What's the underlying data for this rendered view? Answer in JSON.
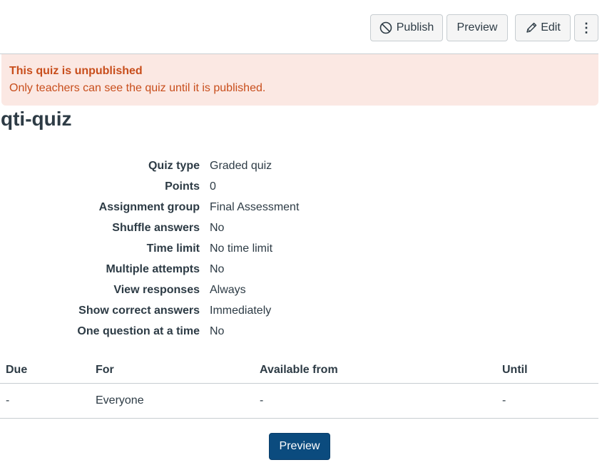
{
  "toolbar": {
    "publish_label": "Publish",
    "preview_label": "Preview",
    "edit_label": "Edit",
    "more_glyph": "⋮"
  },
  "alert": {
    "title": "This quiz is unpublished",
    "body": "Only teachers can see the quiz until it is published."
  },
  "quiz": {
    "title": "qti-quiz"
  },
  "details": [
    {
      "label": "Quiz type",
      "value": "Graded quiz"
    },
    {
      "label": "Points",
      "value": "0"
    },
    {
      "label": "Assignment group",
      "value": "Final Assessment"
    },
    {
      "label": "Shuffle answers",
      "value": "No"
    },
    {
      "label": "Time limit",
      "value": "No time limit"
    },
    {
      "label": "Multiple attempts",
      "value": "No"
    },
    {
      "label": "View responses",
      "value": "Always"
    },
    {
      "label": "Show correct answers",
      "value": "Immediately"
    },
    {
      "label": "One question at a time",
      "value": "No"
    }
  ],
  "dates": {
    "headers": {
      "due": "Due",
      "for": "For",
      "available_from": "Available from",
      "until": "Until"
    },
    "rows": [
      {
        "due": "-",
        "for": "Everyone",
        "available_from": "-",
        "until": "-"
      }
    ]
  },
  "footer": {
    "preview_label": "Preview"
  },
  "colors": {
    "alert_bg": "#fbe8e3",
    "alert_text": "#c84e1c",
    "primary_button": "#0b4b7e",
    "text": "#2d3b45"
  }
}
